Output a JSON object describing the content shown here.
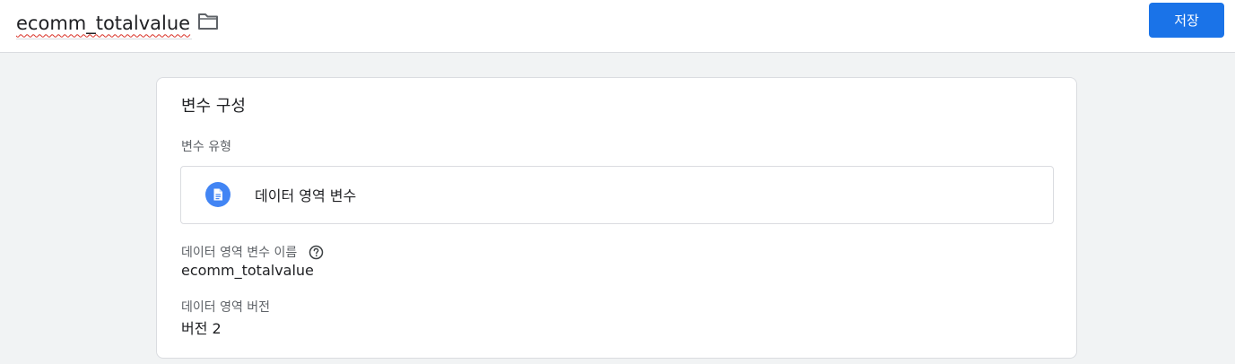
{
  "header": {
    "title": "ecomm_totalvalue",
    "folder_icon": "folder-icon",
    "save_label": "저장",
    "accent_color": "#1a73e8"
  },
  "card": {
    "title": "변수 구성",
    "variable_type_label": "변수 유형",
    "variable_type": {
      "icon": "document-icon",
      "icon_color": "#4285f4",
      "name": "데이터 영역 변수"
    },
    "variable_name_label": "데이터 영역 변수 이름",
    "variable_name_help_icon": "help-circle-icon",
    "variable_name_value": "ecomm_totalvalue",
    "version_label": "데이터 영역 버전",
    "version_value": "버전 2"
  }
}
